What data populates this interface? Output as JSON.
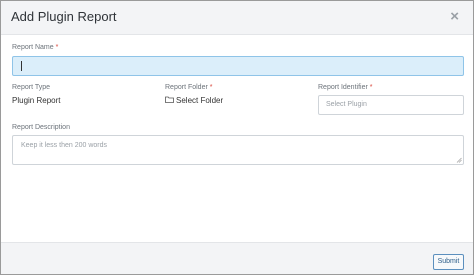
{
  "modal": {
    "title": "Add Plugin Report",
    "close_glyph": "×"
  },
  "form": {
    "report_name": {
      "label": "Report Name",
      "required": "*",
      "value": ""
    },
    "report_type": {
      "label": "Report Type",
      "value": "Plugin Report"
    },
    "report_folder": {
      "label": "Report Folder",
      "required": "*",
      "value": "Select Folder",
      "icon": "folder-icon"
    },
    "report_identifier": {
      "label": "Report Identifier",
      "required": "*",
      "placeholder": "Select Plugin"
    },
    "report_description": {
      "label": "Report Description",
      "placeholder": "Keep it less then 200 words"
    }
  },
  "footer": {
    "submit_label": "Submit"
  },
  "colors": {
    "accent": "#2f5f8a",
    "required": "#d9463b",
    "focused_input": "#dbeefa"
  }
}
